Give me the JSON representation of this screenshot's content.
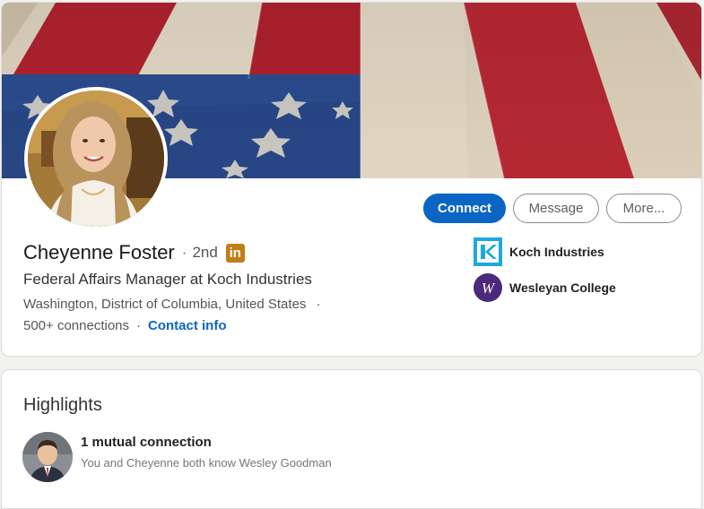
{
  "profile": {
    "name": "Cheyenne Foster",
    "separator": "·",
    "degree": "2nd",
    "linkedin_badge": "in",
    "headline": "Federal Affairs Manager at Koch Industries",
    "location": "Washington, District of Columbia, United States",
    "location_separator": "·",
    "connections": "500+ connections",
    "connections_separator": "·",
    "contact_info": "Contact info"
  },
  "actions": {
    "connect": "Connect",
    "message": "Message",
    "more": "More..."
  },
  "organizations": [
    {
      "name": "Koch Industries",
      "icon": "koch-industries-logo"
    },
    {
      "name": "Wesleyan College",
      "icon": "wesleyan-college-logo"
    }
  ],
  "highlights": {
    "title": "Highlights",
    "mutual_title": "1 mutual connection",
    "mutual_subtitle": "You and Cheyenne both know Wesley Goodman"
  },
  "colors": {
    "primary_blue": "#0a66c2",
    "badge_gold": "#c37d16",
    "page_bg": "#f3f2ef"
  }
}
